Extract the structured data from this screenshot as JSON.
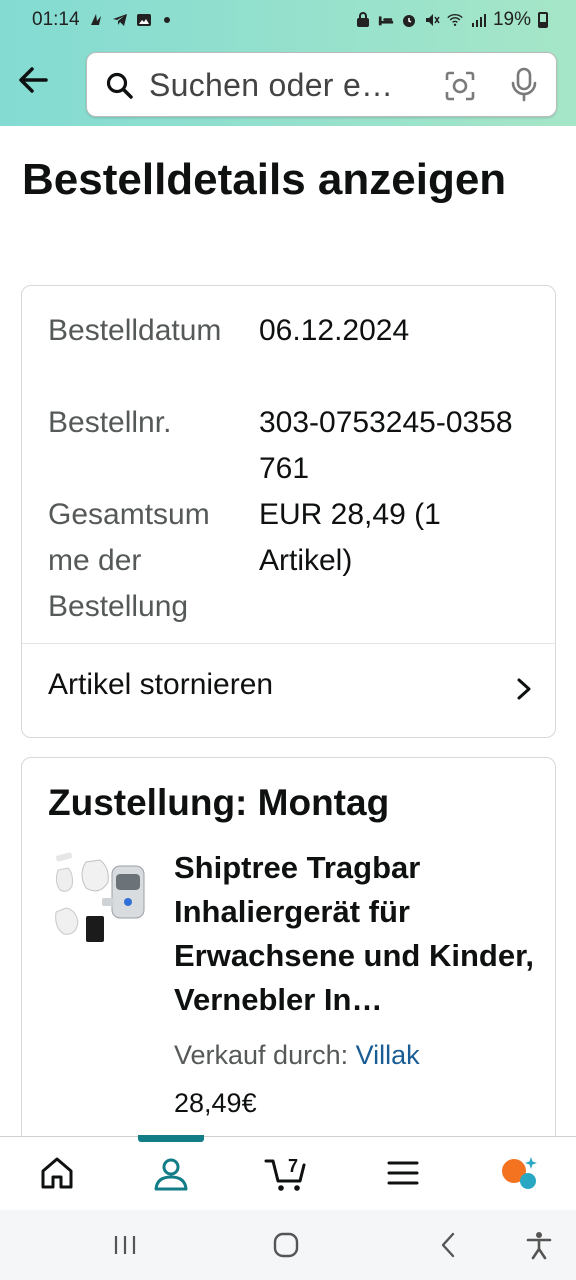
{
  "status_bar": {
    "time": "01:14",
    "battery": "19%"
  },
  "header": {
    "search_placeholder": "Suchen oder e…"
  },
  "page": {
    "title": "Bestelldetails anzeigen"
  },
  "order": {
    "rows": [
      {
        "label": "Bestelldatum",
        "value": "06.12.2024"
      },
      {
        "label": "Bestellnr.",
        "value": "303-0753245-0358761"
      },
      {
        "label": "Gesamtsumme der Bestellung",
        "value": "EUR 28,49 (1 Artikel)"
      }
    ],
    "cancel_label": "Artikel stornieren"
  },
  "delivery": {
    "heading": "Zustellung: Montag",
    "product_title": "Shiptree Tragbar Inhaliergerät für Erwachsene und Kinder, Vernebler In…",
    "seller_prefix": "Verkauf durch: ",
    "seller_name": "Villak",
    "price": "28,49€"
  },
  "bottom_nav": {
    "cart_count": "7",
    "active": "account",
    "accent": "#127c87"
  },
  "colors": {
    "header_gradient_start": "#83dbd2",
    "header_gradient_end": "#a6e6c8",
    "link": "#1a5d95",
    "muted_text": "#565959",
    "assistant_orange": "#f37321",
    "assistant_teal": "#29a8c4"
  }
}
